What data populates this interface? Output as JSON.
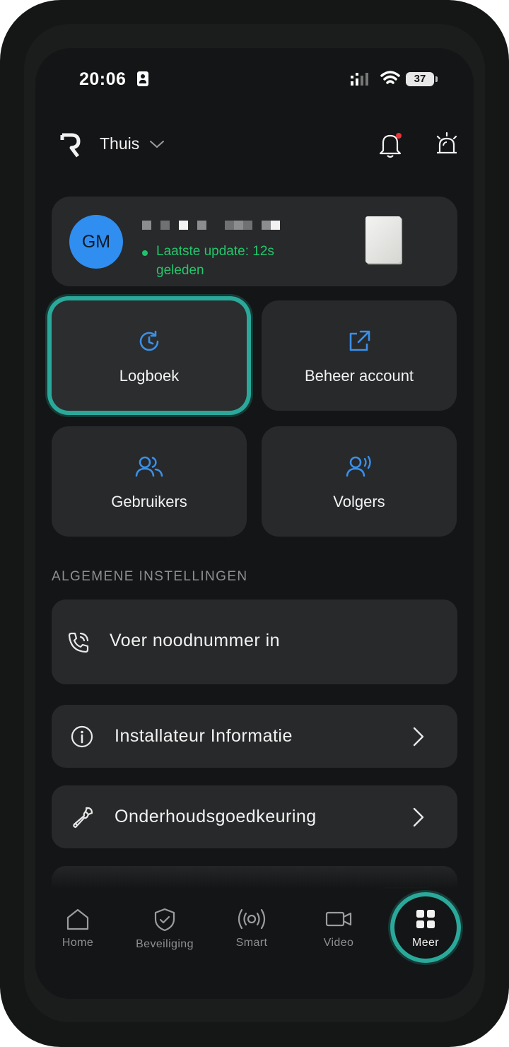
{
  "status_bar": {
    "time": "20:06",
    "battery": "37"
  },
  "header": {
    "home_name": "Thuis"
  },
  "device_card": {
    "avatar_initials": "GM",
    "update_status": "Laatste update: 12s geleden"
  },
  "tiles": [
    {
      "label": "Logboek",
      "icon": "history-icon"
    },
    {
      "label": "Beheer account",
      "icon": "external-link-icon"
    },
    {
      "label": "Gebruikers",
      "icon": "users-icon"
    },
    {
      "label": "Volgers",
      "icon": "followers-icon"
    }
  ],
  "general_settings": {
    "title": "ALGEMENE INSTELLINGEN",
    "items": [
      {
        "label": "Voer noodnummer in",
        "icon": "phone-call-icon"
      },
      {
        "label": "Installateur Informatie",
        "icon": "info-icon"
      },
      {
        "label": "Onderhoudsgoedkeuring",
        "icon": "wrench-icon"
      }
    ]
  },
  "bottom_nav": [
    {
      "label": "Home",
      "icon": "home-icon"
    },
    {
      "label": "Beveiliging",
      "icon": "shield-icon"
    },
    {
      "label": "Smart",
      "icon": "broadcast-icon"
    },
    {
      "label": "Video",
      "icon": "video-icon"
    },
    {
      "label": "Meer",
      "icon": "grid-icon",
      "active": true
    }
  ],
  "colors": {
    "accent_teal": "#2aa99b",
    "icon_blue": "#3b8fe8",
    "status_green": "#22c76b",
    "avatar_blue": "#2f8ef0"
  }
}
